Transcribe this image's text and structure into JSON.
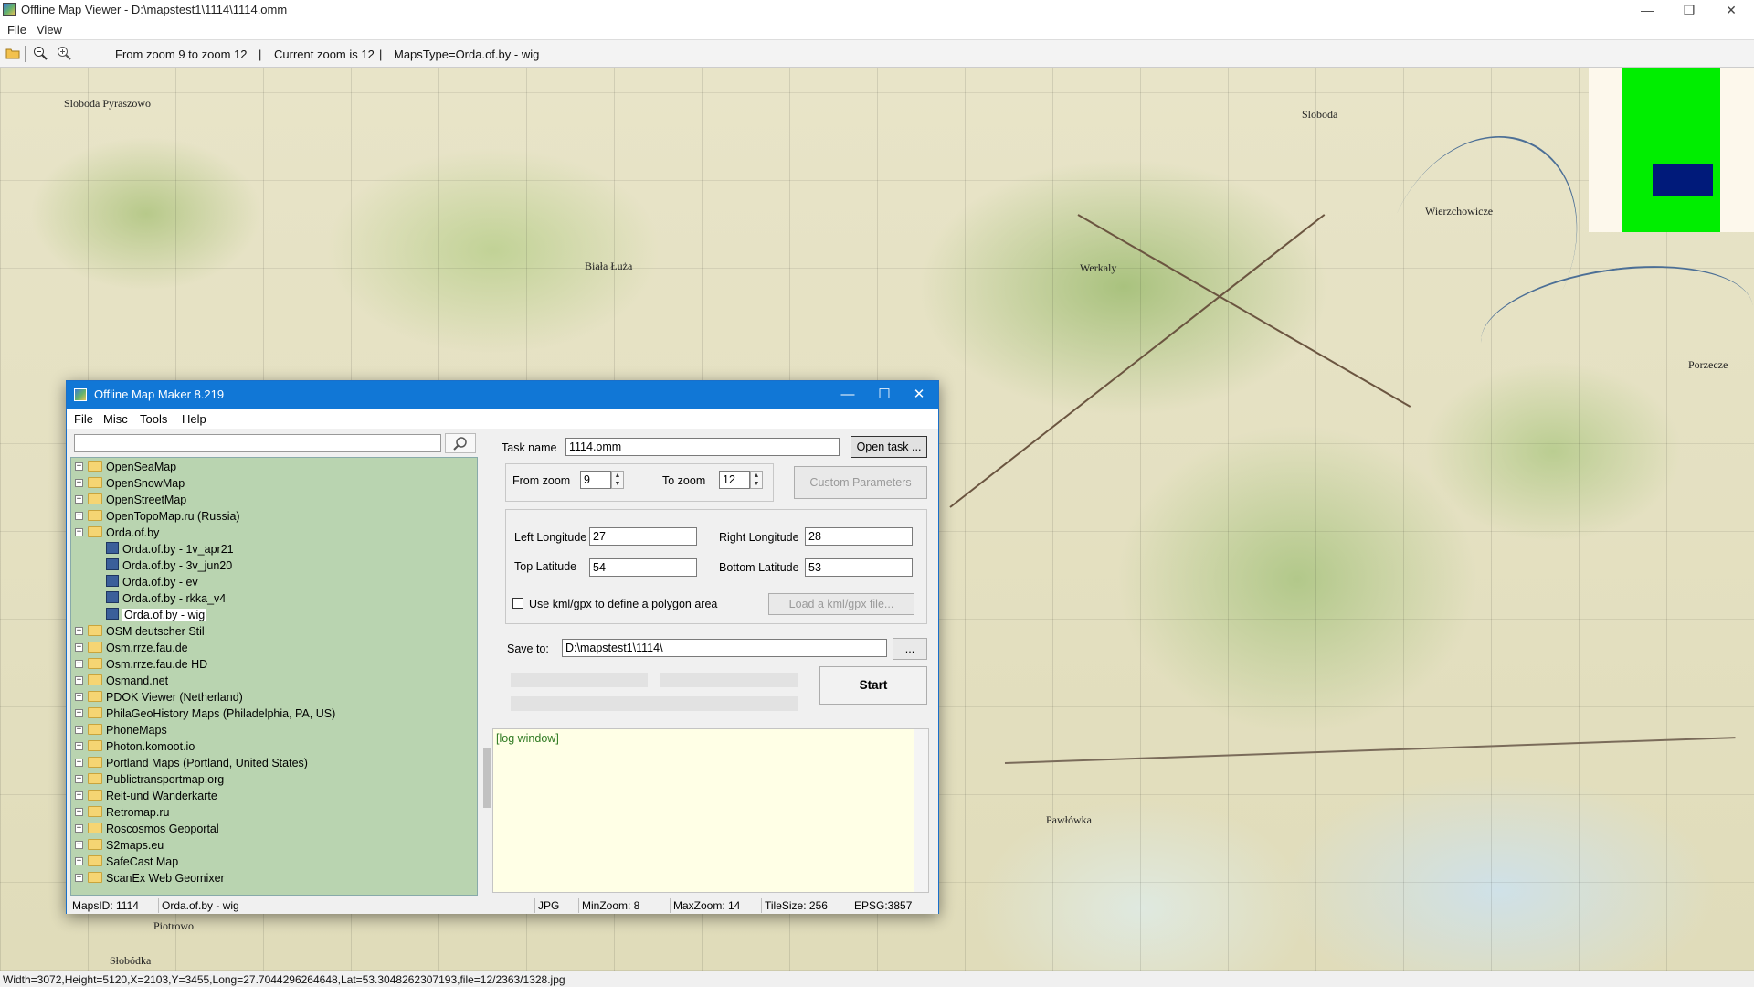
{
  "app": {
    "title": "Offline Map Viewer - D:\\mapstest1\\1114\\1114.omm",
    "menu": [
      "File",
      "View"
    ],
    "window_controls": {
      "minimize": "—",
      "restore": "❐",
      "close": "✕"
    }
  },
  "toolbar": {
    "zoom_range": "From zoom 9 to zoom 12",
    "sep1": "|",
    "current_zoom": "Current zoom is 12",
    "sep2": "|",
    "maps_type": "MapsType=Orda.of.by - wig",
    "icons": [
      "open-folder-icon",
      "zoom-out-icon",
      "zoom-in-icon"
    ]
  },
  "status": {
    "text": "Width=3072,Height=5120,X=2103,Y=3455,Long=27.7044296264648,Lat=53.3048262307193,file=12/2363/1328.jpg"
  },
  "map": {
    "places": [
      "Sloboda Pyraszowo",
      "Biała Łuża",
      "Sloboda",
      "Wierzchowicze",
      "Werkaly",
      "Porzecze",
      "Pawłówka",
      "Piotrowo",
      "Słobódka"
    ]
  },
  "overview": {
    "frame_color": "#00ee00",
    "view_color": "#001a7a"
  },
  "dialog": {
    "title": "Offline Map Maker 8.219",
    "menu": [
      "File",
      "Misc",
      "Tools",
      "Help"
    ],
    "controls": {
      "minimize": "—",
      "maximize": "☐",
      "close": "✕"
    },
    "search": {
      "value": "",
      "placeholder": ""
    },
    "tree": [
      {
        "label": "OpenSeaMap",
        "type": "folder",
        "expanded": false
      },
      {
        "label": "OpenSnowMap",
        "type": "folder",
        "expanded": false
      },
      {
        "label": "OpenStreetMap",
        "type": "folder",
        "expanded": false
      },
      {
        "label": "OpenTopoMap.ru (Russia)",
        "type": "folder",
        "expanded": false
      },
      {
        "label": "Orda.of.by",
        "type": "folder",
        "expanded": true
      },
      {
        "label": "Orda.of.by - 1v_apr21",
        "type": "map",
        "child": true
      },
      {
        "label": "Orda.of.by - 3v_jun20",
        "type": "map",
        "child": true
      },
      {
        "label": "Orda.of.by - ev",
        "type": "map",
        "child": true
      },
      {
        "label": "Orda.of.by - rkka_v4",
        "type": "map",
        "child": true
      },
      {
        "label": "Orda.of.by - wig",
        "type": "map",
        "child": true,
        "selected": true
      },
      {
        "label": "OSM deutscher Stil",
        "type": "folder",
        "expanded": false
      },
      {
        "label": "Osm.rrze.fau.de",
        "type": "folder",
        "expanded": false
      },
      {
        "label": "Osm.rrze.fau.de HD",
        "type": "folder",
        "expanded": false
      },
      {
        "label": "Osmand.net",
        "type": "folder",
        "expanded": false
      },
      {
        "label": "PDOK Viewer (Netherland)",
        "type": "folder",
        "expanded": false
      },
      {
        "label": "PhilaGeoHistory Maps (Philadelphia, PA, US)",
        "type": "folder",
        "expanded": false
      },
      {
        "label": "PhoneMaps",
        "type": "folder",
        "expanded": false
      },
      {
        "label": "Photon.komoot.io",
        "type": "folder",
        "expanded": false
      },
      {
        "label": "Portland Maps (Portland, United States)",
        "type": "folder",
        "expanded": false
      },
      {
        "label": "Publictransportmap.org",
        "type": "folder",
        "expanded": false
      },
      {
        "label": "Reit-und Wanderkarte",
        "type": "folder",
        "expanded": false
      },
      {
        "label": "Retromap.ru",
        "type": "folder",
        "expanded": false
      },
      {
        "label": "Roscosmos Geoportal",
        "type": "folder",
        "expanded": false
      },
      {
        "label": "S2maps.eu",
        "type": "folder",
        "expanded": false
      },
      {
        "label": "SafeCast Map",
        "type": "folder",
        "expanded": false
      },
      {
        "label": "ScanEx Web Geomixer",
        "type": "folder",
        "expanded": false
      }
    ],
    "task_name_label": "Task name",
    "task_name_value": "1114.omm",
    "open_task_label": "Open task ...",
    "from_zoom_label": "From zoom",
    "from_zoom_value": "9",
    "to_zoom_label": "To zoom",
    "to_zoom_value": "12",
    "custom_params_label": "Custom Parameters",
    "left_long_label": "Left Longitude",
    "left_long_value": "27",
    "right_long_label": "Right Longitude",
    "right_long_value": "28",
    "top_lat_label": "Top Latitude",
    "top_lat_value": "54",
    "bottom_lat_label": "Bottom Latitude",
    "bottom_lat_value": "53",
    "kml_checkbox_label": "Use kml/gpx to define a polygon area",
    "kml_checked": false,
    "load_kml_label": "Load a kml/gpx file...",
    "save_to_label": "Save to:",
    "save_to_value": "D:\\mapstest1\\1114\\",
    "browse_label": "...",
    "start_label": "Start",
    "log_text": "[log window]",
    "status": {
      "maps_id": "MapsID: 1114",
      "maps_name": "Orda.of.by - wig",
      "format": "JPG",
      "min_zoom": "MinZoom: 8",
      "max_zoom": "MaxZoom: 14",
      "tile_size": "TileSize: 256",
      "epsg": "EPSG:3857"
    }
  }
}
